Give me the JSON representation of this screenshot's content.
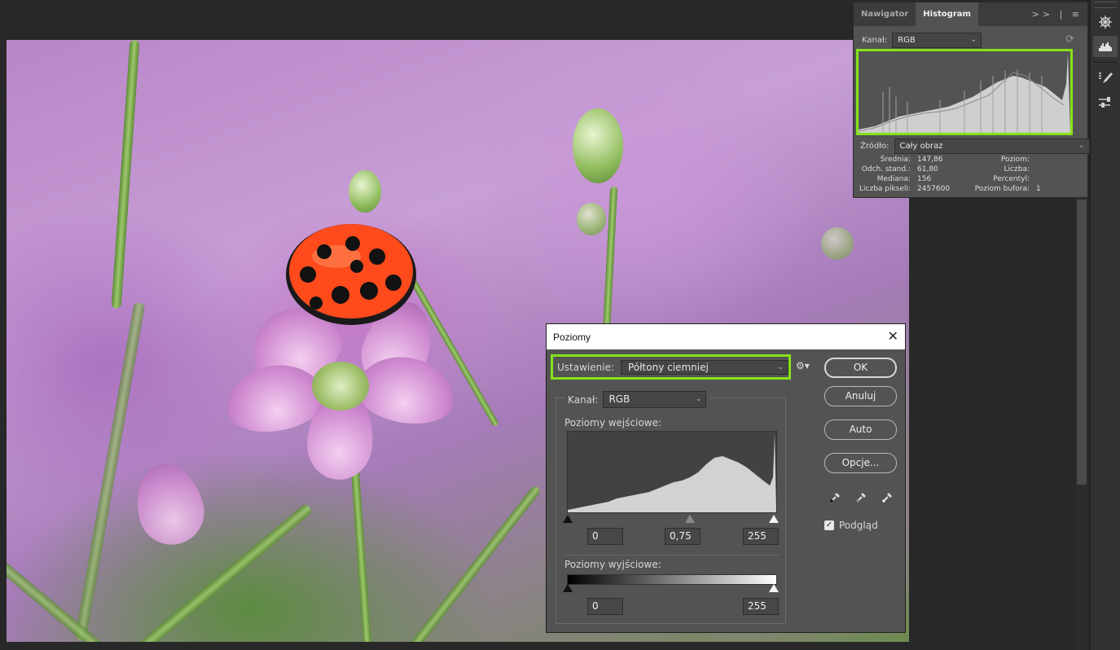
{
  "colors": {
    "highlight": "#86e21a",
    "panel_bg": "#535353",
    "app_bg": "#262626"
  },
  "histogram_panel": {
    "tabs": [
      {
        "label": "Nawigator",
        "active": false
      },
      {
        "label": "Histogram",
        "active": true
      }
    ],
    "menu_icons": ">>  |  ≡",
    "channel_label": "Kanał:",
    "channel_value": "RGB",
    "refresh_icon": "refresh-icon",
    "source_label": "Źródło:",
    "source_value": "Cały obraz",
    "stats_left": [
      {
        "label": "Średnia:",
        "value": "147,86"
      },
      {
        "label": "Odch. stand.:",
        "value": "61,80"
      },
      {
        "label": "Mediana:",
        "value": "156"
      },
      {
        "label": "Liczba pikseli:",
        "value": "2457600"
      }
    ],
    "stats_right": [
      {
        "label": "Poziom:",
        "value": ""
      },
      {
        "label": "Liczba:",
        "value": ""
      },
      {
        "label": "Percentyl:",
        "value": ""
      },
      {
        "label": "Poziom bufora:",
        "value": "1"
      }
    ]
  },
  "right_strip": {
    "icons": [
      "compass-icon",
      "histogram-icon",
      "brush-list-icon",
      "sliders-brush-icon"
    ]
  },
  "levels_dialog": {
    "title": "Poziomy",
    "preset_label": "Ustawienie:",
    "preset_value": "Półtony ciemniej",
    "channel_label": "Kanał:",
    "channel_value": "RGB",
    "input_levels_label": "Poziomy wejściowe:",
    "input_black": "0",
    "input_gamma": "0,75",
    "input_white": "255",
    "output_levels_label": "Poziomy wyjściowe:",
    "output_black": "0",
    "output_white": "255",
    "buttons": {
      "ok": "OK",
      "cancel": "Anuluj",
      "auto": "Auto",
      "options": "Opcje..."
    },
    "preview_label": "Podgląd",
    "preview_checked": true
  }
}
